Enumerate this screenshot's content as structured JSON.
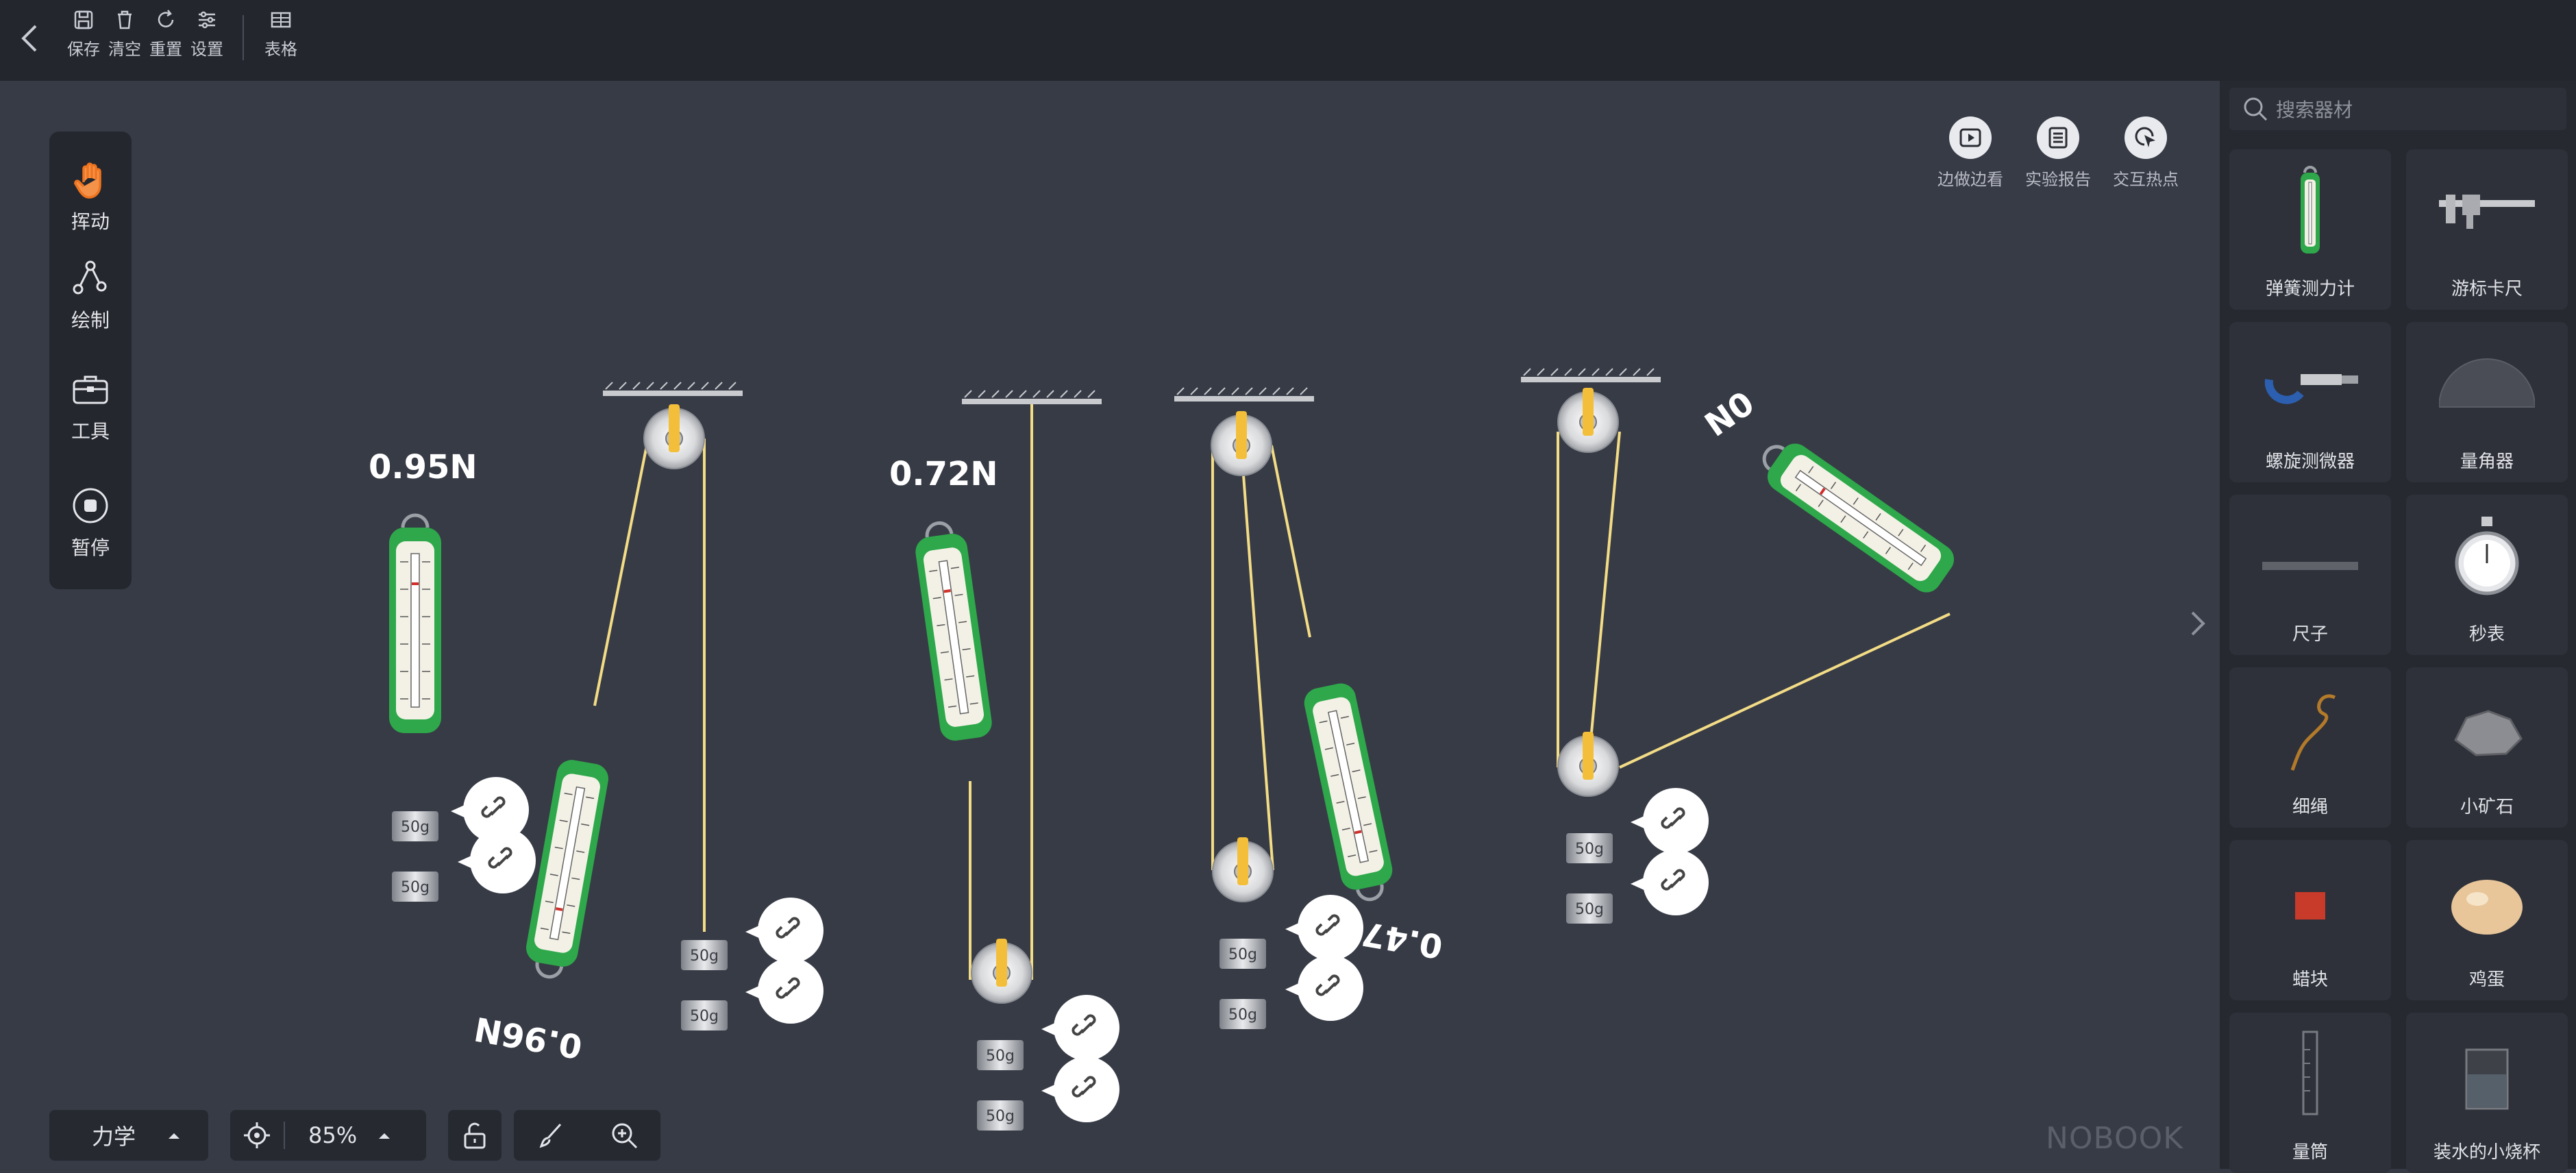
{
  "toolbar": {
    "back_icon": "chevron-left-icon",
    "save": "保存",
    "clear": "清空",
    "reset": "重置",
    "settings": "设置",
    "table": "表格"
  },
  "left_tools": {
    "drag": "挥动",
    "draw": "绘制",
    "tools": "工具",
    "pause": "暂停"
  },
  "top_right": {
    "watch": "边做边看",
    "report": "实验报告",
    "hotspot": "交互热点"
  },
  "search": {
    "placeholder": "搜索器材"
  },
  "equipment": [
    {
      "name": "弹簧测力计",
      "icon": "spring-scale-icon"
    },
    {
      "name": "游标卡尺",
      "icon": "vernier-caliper-icon"
    },
    {
      "name": "螺旋测微器",
      "icon": "micrometer-icon"
    },
    {
      "name": "量角器",
      "icon": "protractor-icon"
    },
    {
      "name": "尺子",
      "icon": "ruler-icon"
    },
    {
      "name": "秒表",
      "icon": "stopwatch-icon"
    },
    {
      "name": "细绳",
      "icon": "string-icon"
    },
    {
      "name": "小矿石",
      "icon": "ore-icon"
    },
    {
      "name": "蜡块",
      "icon": "wax-block-icon"
    },
    {
      "name": "鸡蛋",
      "icon": "egg-icon"
    },
    {
      "name": "量筒",
      "icon": "graduated-cylinder-icon"
    },
    {
      "name": "装水的小烧杯",
      "icon": "beaker-icon"
    }
  ],
  "scene": {
    "readings": [
      "0.95N",
      "0.96N",
      "0.72N",
      "0.47N",
      "0N"
    ],
    "weight_label": "50g"
  },
  "bottom": {
    "category": "力学",
    "zoom": "85%",
    "watermark": "NOBOOK"
  },
  "colors": {
    "topbar": "#24262d",
    "canvas": "#373b46",
    "scale_green": "#2ea84a",
    "rope": "#f3dc86",
    "accent_orange": "#f0741e"
  }
}
